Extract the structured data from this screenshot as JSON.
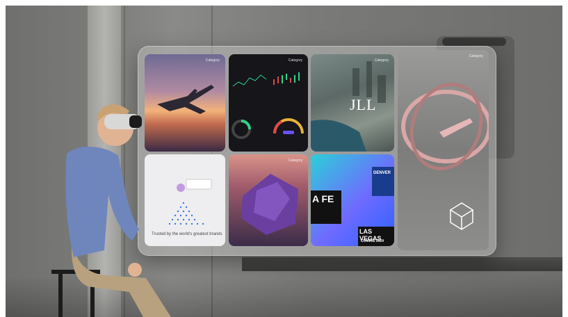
{
  "tiles": {
    "t1": {
      "label": "Category"
    },
    "t2": {
      "label": "Category"
    },
    "t3": {
      "label": "Category"
    },
    "t4": {
      "label": "Category"
    },
    "t5": {
      "caption": "Trusted by the world's greatest brands"
    },
    "t6": {
      "label": "Category"
    },
    "t7": {
      "label": ""
    }
  },
  "jll": {
    "text": "JLL"
  },
  "stickers": {
    "denver": "DENVER",
    "lasvegas": "LAS VEGAS",
    "santafe": "A FE",
    "coming": "COMING 2024"
  }
}
